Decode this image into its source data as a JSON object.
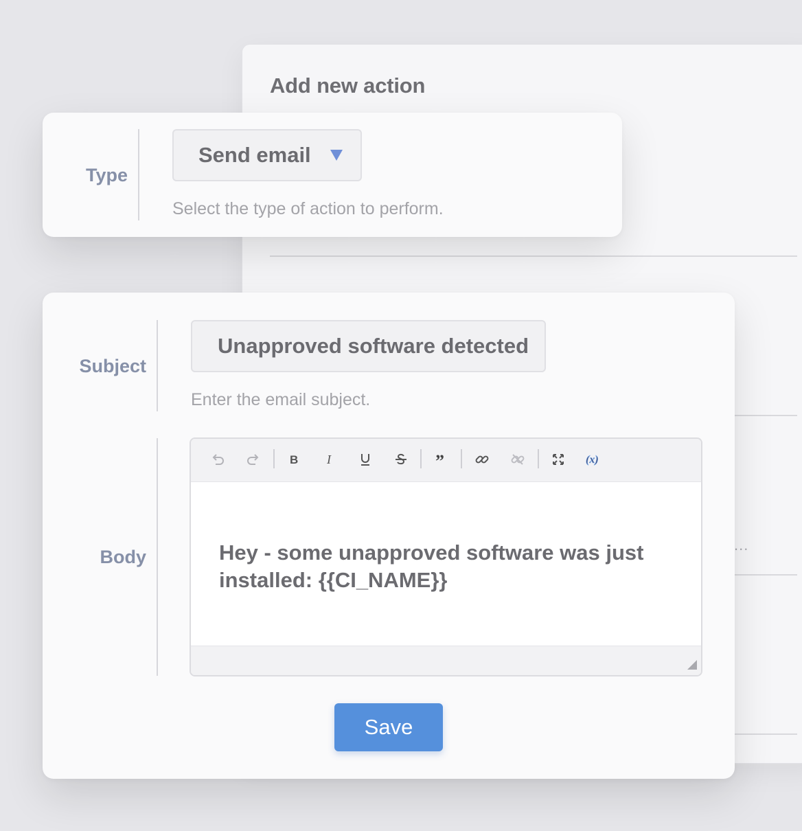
{
  "panel": {
    "title": "Add new action",
    "ellipsis": "..."
  },
  "type_field": {
    "label": "Type",
    "value": "Send email",
    "help": "Select the type of action to perform."
  },
  "subject_field": {
    "label": "Subject",
    "value": "Unapproved software detected",
    "help": "Enter the email subject."
  },
  "body_field": {
    "label": "Body",
    "content_line1": "Hey - some unapproved software was just",
    "content_line2": "installed: {{CI_NAME}}"
  },
  "toolbar": {
    "icons": [
      "undo-icon",
      "redo-icon",
      "bold-icon",
      "italic-icon",
      "underline-icon",
      "strikethrough-icon",
      "quote-icon",
      "link-icon",
      "unlink-icon",
      "fullscreen-icon",
      "variable-icon"
    ]
  },
  "actions": {
    "save_label": "Save"
  },
  "colors": {
    "accent": "#5590dc",
    "label": "#8690a8",
    "arrow": "#6f8fd8"
  }
}
